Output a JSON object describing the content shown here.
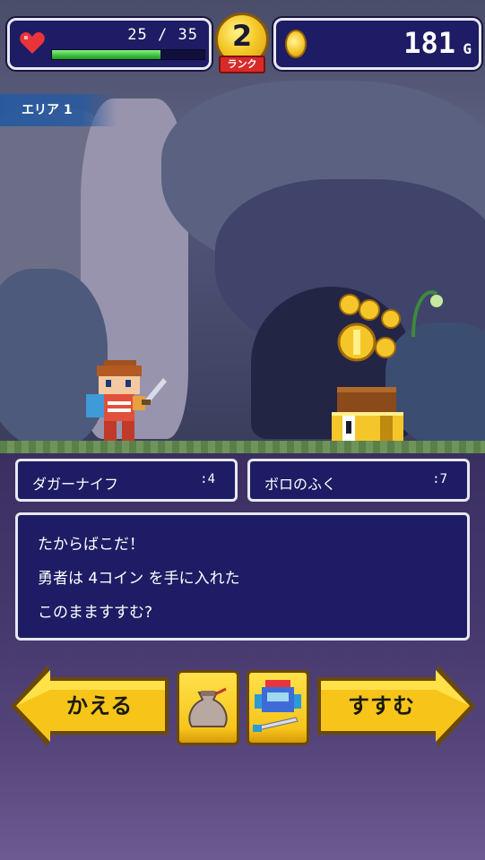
{
  "status": {
    "hp_current": "25",
    "hp_separator": "/",
    "hp_max": "35",
    "hp_fraction": 0.714,
    "rank_number": "2",
    "rank_label": "ランク",
    "gold_amount": "181",
    "gold_unit": "G"
  },
  "area": {
    "name": "エリア 1"
  },
  "equipment": {
    "weapon_name": "ダガーナイフ",
    "weapon_value": ":4",
    "armor_name": "ボロのふく",
    "armor_value": ":7"
  },
  "message": {
    "line1": "たからばこだ！",
    "line2": "勇者は 4コイン を手に入れた",
    "line3": "このまますすむ?"
  },
  "buttons": {
    "back_label": "かえる",
    "go_label": "すすむ",
    "bag_icon": "bag-icon",
    "equip_icon": "equipment-icon"
  },
  "colors": {
    "panel_bg": "#1d1c64",
    "panel_border": "#e8e8f0",
    "button_yellow": "#f7c41a",
    "hp_green": "#3bc13b"
  }
}
